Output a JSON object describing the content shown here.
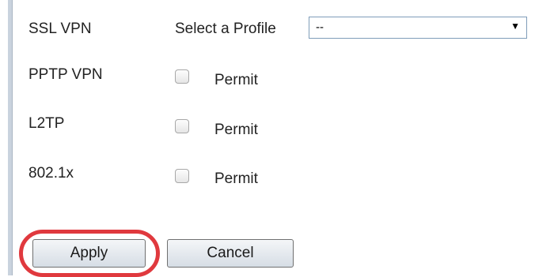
{
  "rows": [
    {
      "label": "SSL VPN"
    },
    {
      "label": "PPTP VPN",
      "checkbox_label": "Permit",
      "checked": false
    },
    {
      "label": "L2TP",
      "checkbox_label": "Permit",
      "checked": false
    },
    {
      "label": "802.1x",
      "checkbox_label": "Permit",
      "checked": false
    }
  ],
  "ssl_vpn": {
    "profile_label": "Select a Profile",
    "profile_value": "--"
  },
  "buttons": {
    "apply": "Apply",
    "cancel": "Cancel"
  },
  "colors": {
    "highlight": "#e0393e",
    "select_border": "#7f9db9"
  },
  "icons": {
    "select_arrow": "▼"
  }
}
